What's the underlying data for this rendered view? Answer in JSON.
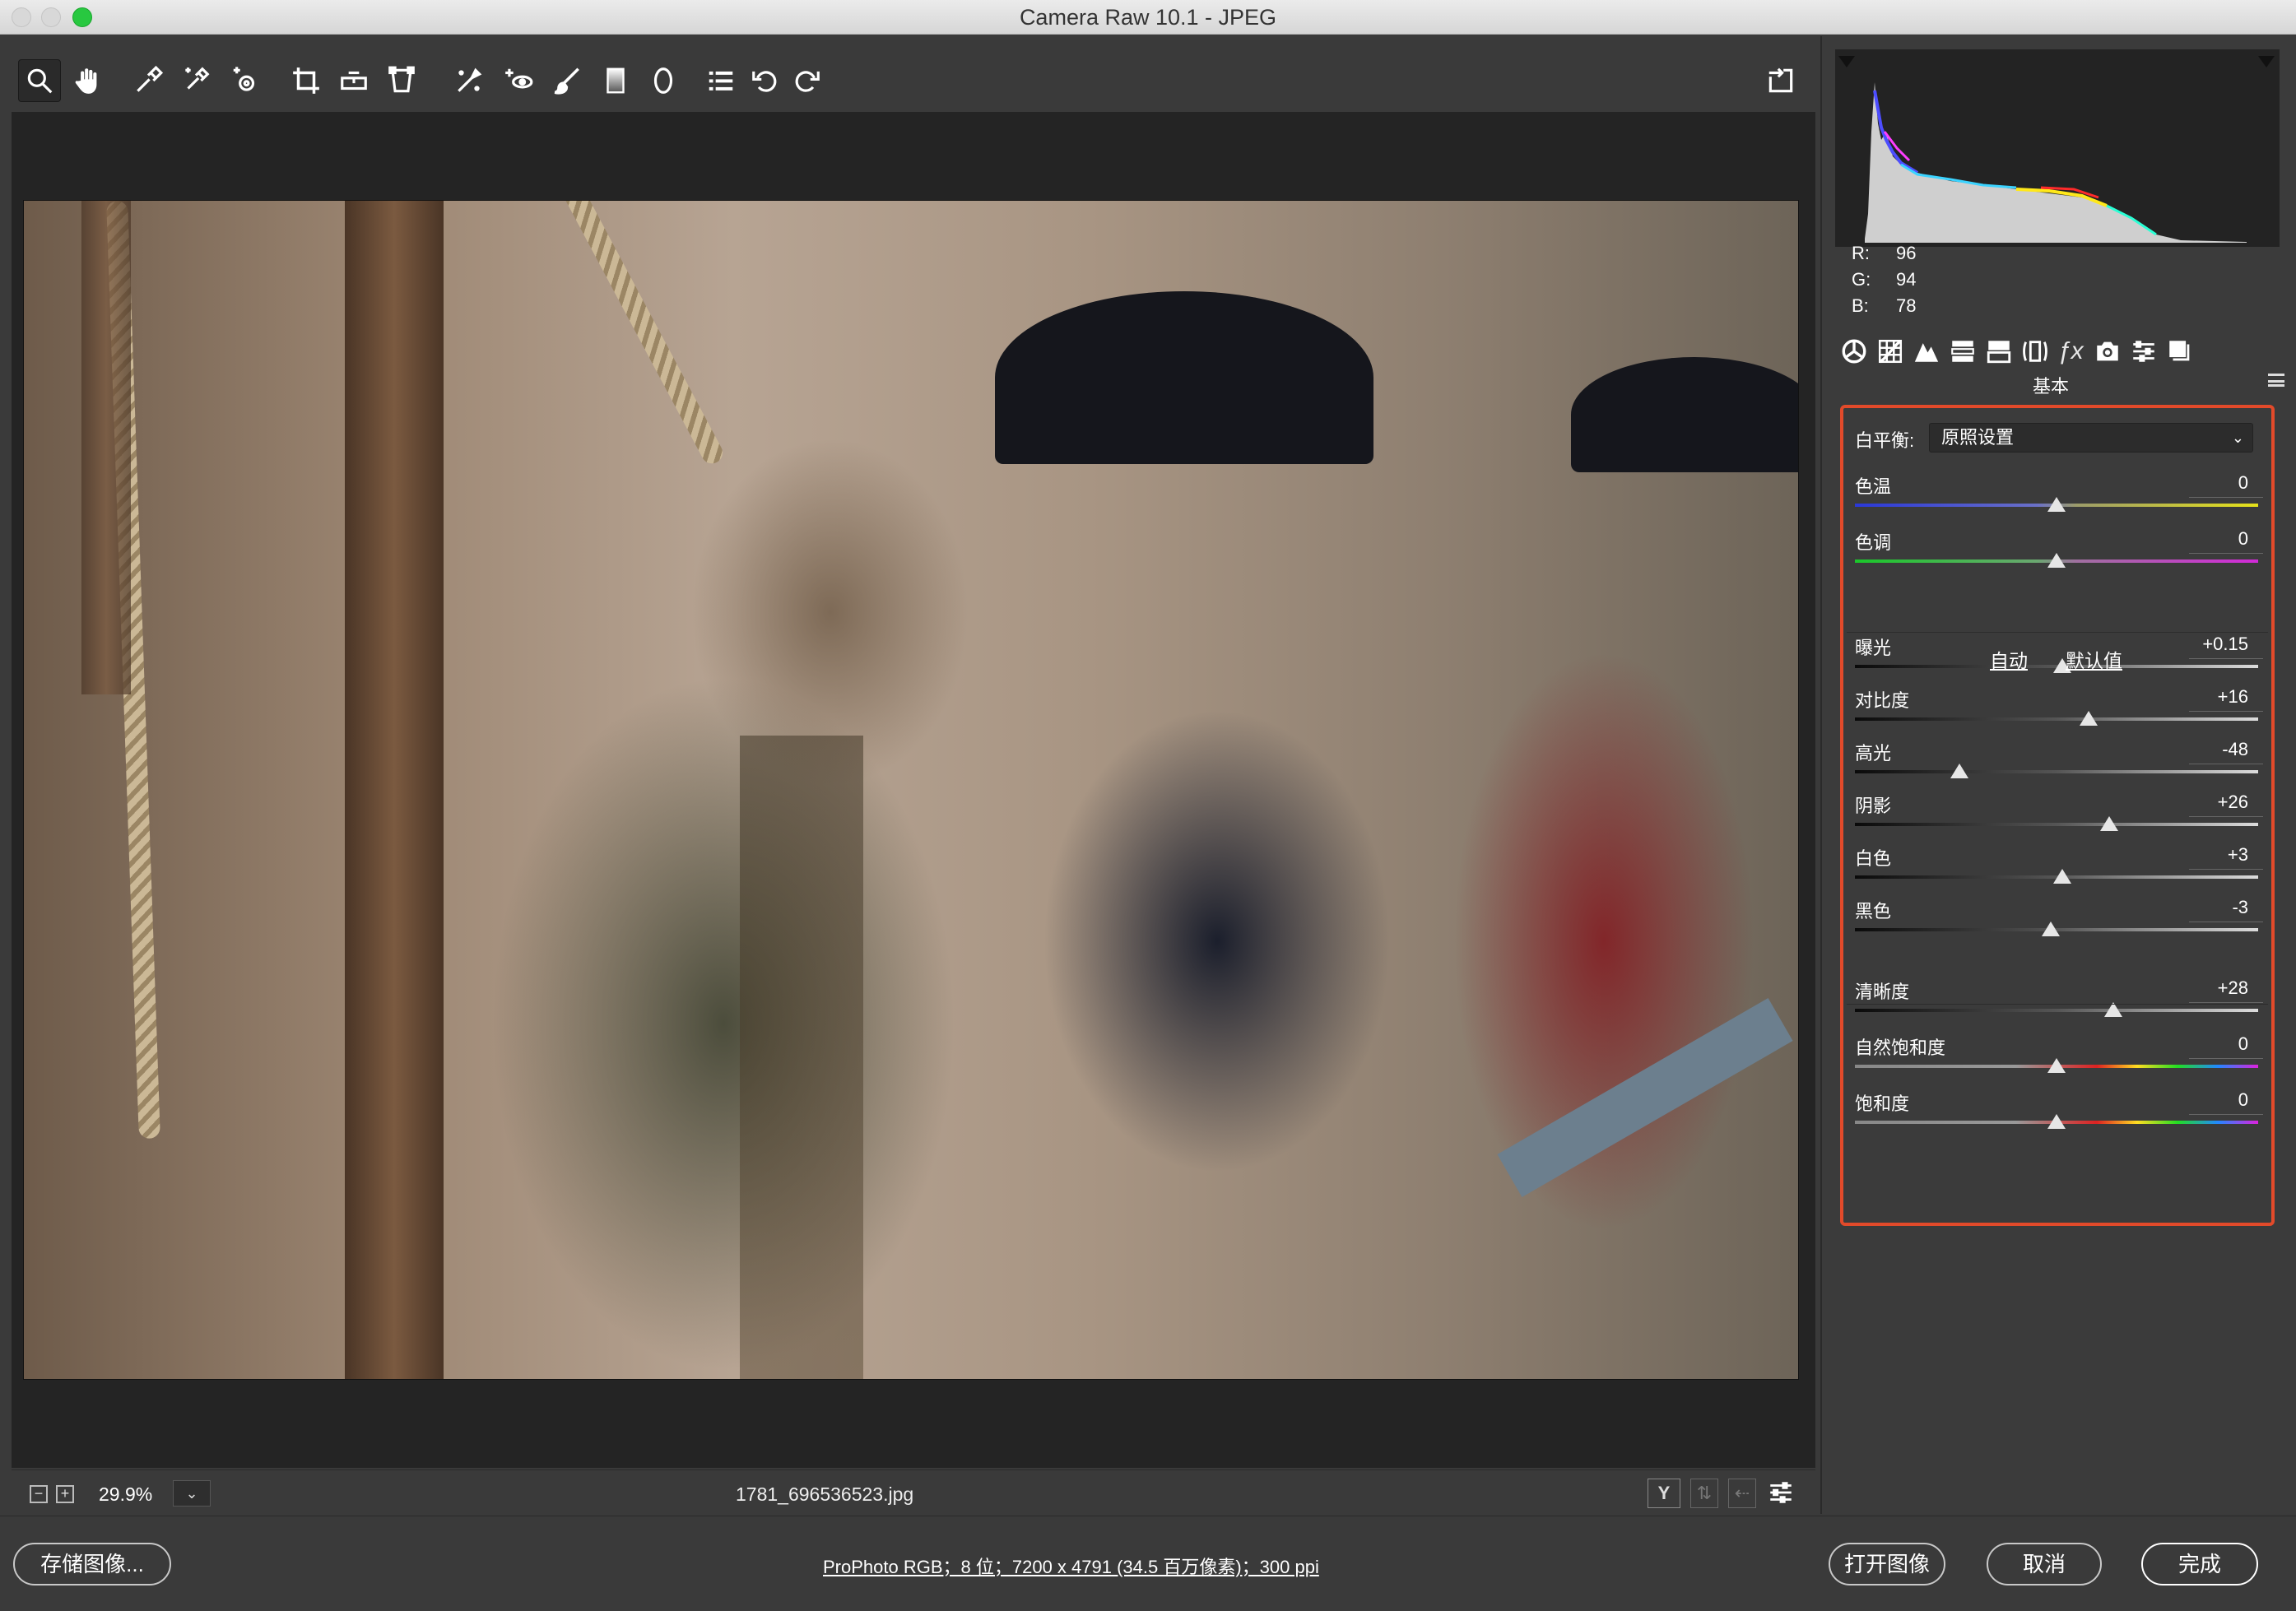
{
  "window": {
    "title": "Camera Raw 10.1 -  JPEG"
  },
  "colors": {
    "accent_box": "#e24a2a",
    "panel_bg": "#3b3b3b",
    "canvas_bg": "#242424"
  },
  "toolbar": {
    "tools": [
      {
        "name": "zoom-tool",
        "icon": "magnifier-icon"
      },
      {
        "name": "hand-tool",
        "icon": "hand-icon"
      },
      {
        "name": "white-balance-tool",
        "icon": "eyedropper-icon"
      },
      {
        "name": "color-sampler-tool",
        "icon": "color-sampler-icon"
      },
      {
        "name": "targeted-adjustment-tool",
        "icon": "target-adjust-icon"
      },
      {
        "name": "crop-tool",
        "icon": "crop-icon"
      },
      {
        "name": "straighten-tool",
        "icon": "level-icon"
      },
      {
        "name": "transform-tool",
        "icon": "transform-icon"
      },
      {
        "name": "spot-removal-tool",
        "icon": "spot-removal-icon"
      },
      {
        "name": "red-eye-tool",
        "icon": "red-eye-icon"
      },
      {
        "name": "adjustment-brush-tool",
        "icon": "brush-icon"
      },
      {
        "name": "graduated-filter-tool",
        "icon": "graduated-filter-icon"
      },
      {
        "name": "radial-filter-tool",
        "icon": "radial-filter-icon"
      },
      {
        "name": "preferences-tool",
        "icon": "list-icon"
      },
      {
        "name": "rotate-ccw-tool",
        "icon": "rotate-ccw-icon"
      },
      {
        "name": "rotate-cw-tool",
        "icon": "rotate-cw-icon"
      }
    ],
    "fullscreen_icon": "export-icon"
  },
  "status": {
    "zoom": "29.9%",
    "filename": "1781_696536523.jpg"
  },
  "histogram": {
    "readout": {
      "r_label": "R:",
      "r": "96",
      "g_label": "G:",
      "g": "94",
      "b_label": "B:",
      "b": "78"
    }
  },
  "panel": {
    "title": "基本",
    "tabs": [
      "basic-icon",
      "tone-curve-icon",
      "detail-icon",
      "hsl-icon",
      "split-toning-icon",
      "lens-icon",
      "fx-icon",
      "camera-calibration-icon",
      "presets-icon",
      "snapshots-icon"
    ],
    "white_balance": {
      "label": "白平衡:",
      "value": "原照设置"
    },
    "auto_label": "自动",
    "default_label": "默认值",
    "sliders": [
      {
        "id": "temp",
        "label": "色温",
        "value": "0",
        "level": 0,
        "min": -100,
        "max": 100,
        "track": "temp"
      },
      {
        "id": "tint",
        "label": "色调",
        "value": "0",
        "level": 0,
        "min": -100,
        "max": 100,
        "track": "tint"
      },
      {
        "id": "exposure",
        "label": "曝光",
        "value": "+0.15",
        "level": 0.15,
        "min": -5,
        "max": 5,
        "track": "gray"
      },
      {
        "id": "contrast",
        "label": "对比度",
        "value": "+16",
        "level": 16,
        "min": -100,
        "max": 100,
        "track": "gray"
      },
      {
        "id": "highlights",
        "label": "高光",
        "value": "-48",
        "level": -48,
        "min": -100,
        "max": 100,
        "track": "gray"
      },
      {
        "id": "shadows",
        "label": "阴影",
        "value": "+26",
        "level": 26,
        "min": -100,
        "max": 100,
        "track": "gray"
      },
      {
        "id": "whites",
        "label": "白色",
        "value": "+3",
        "level": 3,
        "min": -100,
        "max": 100,
        "track": "gray"
      },
      {
        "id": "blacks",
        "label": "黑色",
        "value": "-3",
        "level": -3,
        "min": -100,
        "max": 100,
        "track": "gray"
      },
      {
        "id": "clarity",
        "label": "清晰度",
        "value": "+28",
        "level": 28,
        "min": -100,
        "max": 100,
        "track": "gray"
      },
      {
        "id": "vibrance",
        "label": "自然饱和度",
        "value": "0",
        "level": 0,
        "min": -100,
        "max": 100,
        "track": "sat"
      },
      {
        "id": "saturation",
        "label": "饱和度",
        "value": "0",
        "level": 0,
        "min": -100,
        "max": 100,
        "track": "sat"
      }
    ]
  },
  "footer": {
    "save_label": "存储图像...",
    "workflow": "ProPhoto RGB；8 位；7200 x 4791 (34.5 百万像素)；300 ppi",
    "open_label": "打开图像",
    "cancel_label": "取消",
    "done_label": "完成"
  }
}
